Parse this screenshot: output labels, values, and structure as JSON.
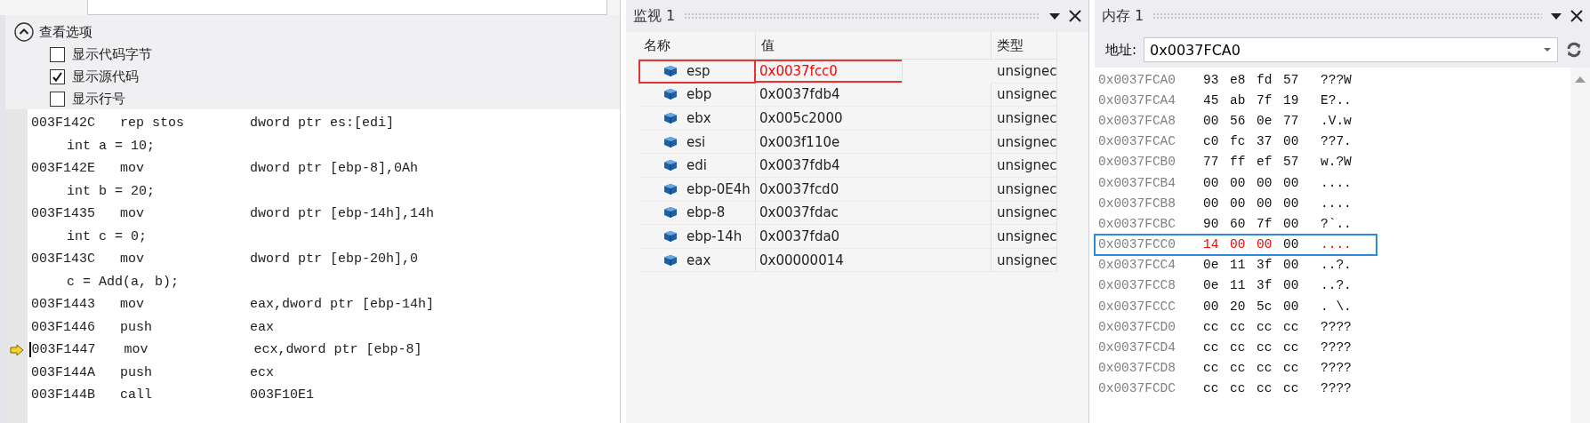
{
  "disassembly": {
    "view_options": {
      "title": "查看选项",
      "expanded": true,
      "options": [
        {
          "label": "显示代码字节",
          "checked": false
        },
        {
          "label": "显示源代码",
          "checked": true
        },
        {
          "label": "显示行号",
          "checked": false
        }
      ]
    },
    "lines": [
      {
        "kind": "asm",
        "address": "003F142C",
        "mnemonic": "rep stos",
        "operands": "dword ptr es:[edi]",
        "current": false
      },
      {
        "kind": "source",
        "text": "int a = 10;"
      },
      {
        "kind": "asm",
        "address": "003F142E",
        "mnemonic": "mov",
        "operands": "dword ptr [ebp-8],0Ah",
        "current": false
      },
      {
        "kind": "source",
        "text": "int b = 20;"
      },
      {
        "kind": "asm",
        "address": "003F1435",
        "mnemonic": "mov",
        "operands": "dword ptr [ebp-14h],14h",
        "current": false
      },
      {
        "kind": "source",
        "text": "int c = 0;"
      },
      {
        "kind": "asm",
        "address": "003F143C",
        "mnemonic": "mov",
        "operands": "dword ptr [ebp-20h],0",
        "current": false
      },
      {
        "kind": "source",
        "text": "c = Add(a, b);"
      },
      {
        "kind": "asm",
        "address": "003F1443",
        "mnemonic": "mov",
        "operands": "eax,dword ptr [ebp-14h]",
        "current": false
      },
      {
        "kind": "asm",
        "address": "003F1446",
        "mnemonic": "push",
        "operands": "eax",
        "current": false
      },
      {
        "kind": "asm",
        "address": "003F1447",
        "mnemonic": "mov",
        "operands": "ecx,dword ptr [ebp-8]",
        "current": true
      },
      {
        "kind": "asm",
        "address": "003F144A",
        "mnemonic": "push",
        "operands": "ecx",
        "current": false
      },
      {
        "kind": "asm",
        "address": "003F144B",
        "mnemonic": "call",
        "operands": "003F10E1",
        "current": false
      }
    ]
  },
  "watch": {
    "title": "监视 1",
    "columns": [
      "名称",
      "值",
      "类型"
    ],
    "rows": [
      {
        "name": "esp",
        "value": "0x0037fcc0",
        "type": "unsignec",
        "changed": true,
        "highlighted": true
      },
      {
        "name": "ebp",
        "value": "0x0037fdb4",
        "type": "unsignec",
        "changed": false,
        "highlighted": false
      },
      {
        "name": "ebx",
        "value": "0x005c2000",
        "type": "unsignec",
        "changed": false,
        "highlighted": false
      },
      {
        "name": "esi",
        "value": "0x003f110e",
        "type": "unsignec",
        "changed": false,
        "highlighted": false
      },
      {
        "name": "edi",
        "value": "0x0037fdb4",
        "type": "unsignec",
        "changed": false,
        "highlighted": false
      },
      {
        "name": "ebp-0E4h",
        "value": "0x0037fcd0",
        "type": "unsignec",
        "changed": false,
        "highlighted": false
      },
      {
        "name": "ebp-8",
        "value": "0x0037fdac",
        "type": "unsignec",
        "changed": false,
        "highlighted": false
      },
      {
        "name": "ebp-14h",
        "value": "0x0037fda0",
        "type": "unsignec",
        "changed": false,
        "highlighted": false
      },
      {
        "name": "eax",
        "value": "0x00000014",
        "type": "unsignec",
        "changed": false,
        "highlighted": false
      }
    ]
  },
  "memory": {
    "title": "内存 1",
    "address_label": "地址:",
    "address": "0x0037FCA0",
    "rows": [
      {
        "address": "0x0037FCA0",
        "bytes": [
          {
            "value": "93",
            "changed": false
          },
          {
            "value": "e8",
            "changed": false
          },
          {
            "value": "fd",
            "changed": false
          },
          {
            "value": "57",
            "changed": false
          }
        ],
        "ascii": "???W",
        "ascii_changed": false,
        "highlighted": false
      },
      {
        "address": "0x0037FCA4",
        "bytes": [
          {
            "value": "45",
            "changed": false
          },
          {
            "value": "ab",
            "changed": false
          },
          {
            "value": "7f",
            "changed": false
          },
          {
            "value": "19",
            "changed": false
          }
        ],
        "ascii": "E?..",
        "ascii_changed": false,
        "highlighted": false
      },
      {
        "address": "0x0037FCA8",
        "bytes": [
          {
            "value": "00",
            "changed": false
          },
          {
            "value": "56",
            "changed": false
          },
          {
            "value": "0e",
            "changed": false
          },
          {
            "value": "77",
            "changed": false
          }
        ],
        "ascii": ".V.w",
        "ascii_changed": false,
        "highlighted": false
      },
      {
        "address": "0x0037FCAC",
        "bytes": [
          {
            "value": "c0",
            "changed": false
          },
          {
            "value": "fc",
            "changed": false
          },
          {
            "value": "37",
            "changed": false
          },
          {
            "value": "00",
            "changed": false
          }
        ],
        "ascii": "??7.",
        "ascii_changed": false,
        "highlighted": false
      },
      {
        "address": "0x0037FCB0",
        "bytes": [
          {
            "value": "77",
            "changed": false
          },
          {
            "value": "ff",
            "changed": false
          },
          {
            "value": "ef",
            "changed": false
          },
          {
            "value": "57",
            "changed": false
          }
        ],
        "ascii": "w.?W",
        "ascii_changed": false,
        "highlighted": false
      },
      {
        "address": "0x0037FCB4",
        "bytes": [
          {
            "value": "00",
            "changed": false
          },
          {
            "value": "00",
            "changed": false
          },
          {
            "value": "00",
            "changed": false
          },
          {
            "value": "00",
            "changed": false
          }
        ],
        "ascii": "....",
        "ascii_changed": false,
        "highlighted": false
      },
      {
        "address": "0x0037FCB8",
        "bytes": [
          {
            "value": "00",
            "changed": false
          },
          {
            "value": "00",
            "changed": false
          },
          {
            "value": "00",
            "changed": false
          },
          {
            "value": "00",
            "changed": false
          }
        ],
        "ascii": "....",
        "ascii_changed": false,
        "highlighted": false
      },
      {
        "address": "0x0037FCBC",
        "bytes": [
          {
            "value": "90",
            "changed": false
          },
          {
            "value": "60",
            "changed": false
          },
          {
            "value": "7f",
            "changed": false
          },
          {
            "value": "00",
            "changed": false
          }
        ],
        "ascii": "?`..",
        "ascii_changed": false,
        "highlighted": false
      },
      {
        "address": "0x0037FCC0",
        "bytes": [
          {
            "value": "14",
            "changed": true
          },
          {
            "value": "00",
            "changed": true
          },
          {
            "value": "00",
            "changed": true
          },
          {
            "value": "00",
            "changed": false
          }
        ],
        "ascii": "....",
        "ascii_changed": true,
        "highlighted": true
      },
      {
        "address": "0x0037FCC4",
        "bytes": [
          {
            "value": "0e",
            "changed": false
          },
          {
            "value": "11",
            "changed": false
          },
          {
            "value": "3f",
            "changed": false
          },
          {
            "value": "00",
            "changed": false
          }
        ],
        "ascii": "..?.",
        "ascii_changed": false,
        "highlighted": false
      },
      {
        "address": "0x0037FCC8",
        "bytes": [
          {
            "value": "0e",
            "changed": false
          },
          {
            "value": "11",
            "changed": false
          },
          {
            "value": "3f",
            "changed": false
          },
          {
            "value": "00",
            "changed": false
          }
        ],
        "ascii": "..?.",
        "ascii_changed": false,
        "highlighted": false
      },
      {
        "address": "0x0037FCCC",
        "bytes": [
          {
            "value": "00",
            "changed": false
          },
          {
            "value": "20",
            "changed": false
          },
          {
            "value": "5c",
            "changed": false
          },
          {
            "value": "00",
            "changed": false
          }
        ],
        "ascii": ". \\.",
        "ascii_changed": false,
        "highlighted": false
      },
      {
        "address": "0x0037FCD0",
        "bytes": [
          {
            "value": "cc",
            "changed": false
          },
          {
            "value": "cc",
            "changed": false
          },
          {
            "value": "cc",
            "changed": false
          },
          {
            "value": "cc",
            "changed": false
          }
        ],
        "ascii": "????",
        "ascii_changed": false,
        "highlighted": false
      },
      {
        "address": "0x0037FCD4",
        "bytes": [
          {
            "value": "cc",
            "changed": false
          },
          {
            "value": "cc",
            "changed": false
          },
          {
            "value": "cc",
            "changed": false
          },
          {
            "value": "cc",
            "changed": false
          }
        ],
        "ascii": "????",
        "ascii_changed": false,
        "highlighted": false
      },
      {
        "address": "0x0037FCD8",
        "bytes": [
          {
            "value": "cc",
            "changed": false
          },
          {
            "value": "cc",
            "changed": false
          },
          {
            "value": "cc",
            "changed": false
          },
          {
            "value": "cc",
            "changed": false
          }
        ],
        "ascii": "????",
        "ascii_changed": false,
        "highlighted": false
      },
      {
        "address": "0x0037FCDC",
        "bytes": [
          {
            "value": "cc",
            "changed": false
          },
          {
            "value": "cc",
            "changed": false
          },
          {
            "value": "cc",
            "changed": false
          },
          {
            "value": "cc",
            "changed": false
          }
        ],
        "ascii": "????",
        "ascii_changed": false,
        "highlighted": false
      }
    ]
  }
}
